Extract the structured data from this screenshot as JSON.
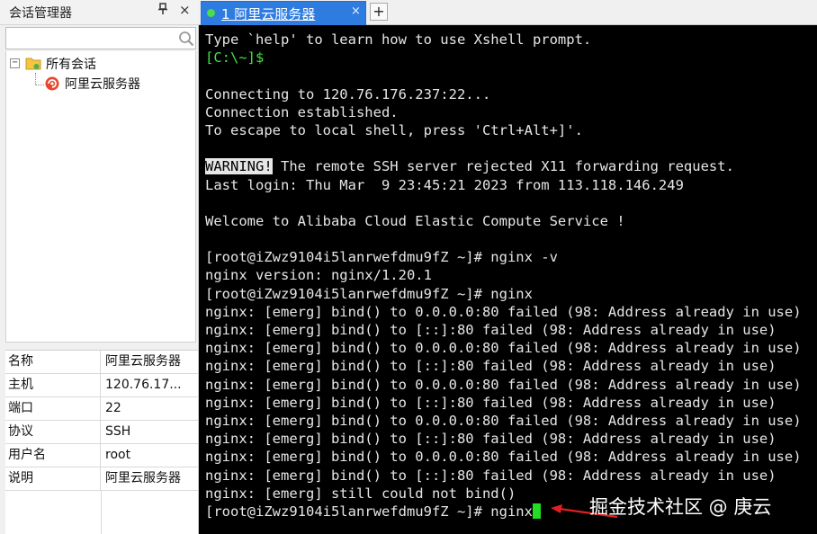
{
  "session_manager": {
    "title": "会话管理器",
    "pin_icon": "pin-icon",
    "close_label": "×",
    "search": {
      "placeholder": "",
      "value": ""
    },
    "tree": {
      "root_label": "所有会话",
      "expander": "⊟",
      "children": [
        {
          "label": "阿里云服务器",
          "icon": "session-icon"
        }
      ]
    },
    "properties": [
      {
        "key": "名称",
        "value": "阿里云服务器"
      },
      {
        "key": "主机",
        "value": "120.76.17..."
      },
      {
        "key": "端口",
        "value": "22"
      },
      {
        "key": "协议",
        "value": "SSH"
      },
      {
        "key": "用户名",
        "value": "root"
      },
      {
        "key": "说明",
        "value": "阿里云服务器"
      }
    ]
  },
  "tabs": {
    "active": {
      "label": "1 阿里云服务器",
      "close": "×",
      "status_color": "#4cdc4c"
    },
    "add_label": "+"
  },
  "terminal": {
    "lines": [
      "Type `help' to learn how to use Xshell prompt.",
      "[C:\\~]$",
      "",
      "Connecting to 120.76.176.237:22...",
      "Connection established.",
      "To escape to local shell, press 'Ctrl+Alt+]'.",
      "",
      "WARNING! The remote SSH server rejected X11 forwarding request.",
      "Last login: Thu Mar  9 23:45:21 2023 from 113.118.146.249",
      "",
      "Welcome to Alibaba Cloud Elastic Compute Service !",
      "",
      "[root@iZwz9104i5lanrwefdmu9fZ ~]# nginx -v",
      "nginx version: nginx/1.20.1",
      "[root@iZwz9104i5lanrwefdmu9fZ ~]# nginx",
      "nginx: [emerg] bind() to 0.0.0.0:80 failed (98: Address already in use)",
      "nginx: [emerg] bind() to [::]:80 failed (98: Address already in use)",
      "nginx: [emerg] bind() to 0.0.0.0:80 failed (98: Address already in use)",
      "nginx: [emerg] bind() to [::]:80 failed (98: Address already in use)",
      "nginx: [emerg] bind() to 0.0.0.0:80 failed (98: Address already in use)",
      "nginx: [emerg] bind() to [::]:80 failed (98: Address already in use)",
      "nginx: [emerg] bind() to 0.0.0.0:80 failed (98: Address already in use)",
      "nginx: [emerg] bind() to [::]:80 failed (98: Address already in use)",
      "nginx: [emerg] bind() to 0.0.0.0:80 failed (98: Address already in use)",
      "nginx: [emerg] bind() to [::]:80 failed (98: Address already in use)",
      "nginx: [emerg] still could not bind()",
      "[root@iZwz9104i5lanrwefdmu9fZ ~]# nginx"
    ],
    "green_line_indices": [
      1
    ],
    "warning_highlight": "WARNING!",
    "cursor_color": "#22dd22"
  },
  "watermark": "掘金技术社区 @ 庚云",
  "colors": {
    "terminal_bg": "#000000",
    "terminal_fg": "#e6e6e6",
    "prompt_green": "#42e342",
    "tab_active": "#2f7ce0",
    "arrow": "#e02020"
  }
}
